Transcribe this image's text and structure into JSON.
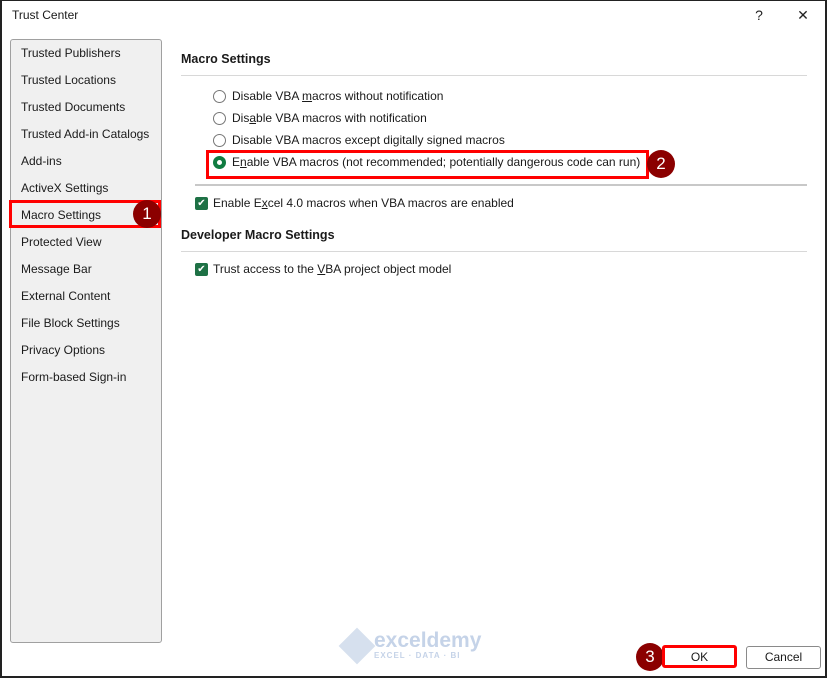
{
  "window": {
    "title": "Trust Center",
    "help_icon": "?",
    "close_icon": "✕"
  },
  "sidebar": {
    "items": [
      {
        "label": "Trusted Publishers"
      },
      {
        "label": "Trusted Locations"
      },
      {
        "label": "Trusted Documents"
      },
      {
        "label": "Trusted Add-in Catalogs"
      },
      {
        "label": "Add-ins"
      },
      {
        "label": "ActiveX Settings"
      },
      {
        "label": "Macro Settings",
        "selected": true
      },
      {
        "label": "Protected View"
      },
      {
        "label": "Message Bar"
      },
      {
        "label": "External Content"
      },
      {
        "label": "File Block Settings"
      },
      {
        "label": "Privacy Options"
      },
      {
        "label": "Form-based Sign-in"
      }
    ]
  },
  "macro": {
    "heading": "Macro Settings",
    "options": [
      {
        "pre": "Disable VBA ",
        "key": "m",
        "post": "acros without notification",
        "checked": false
      },
      {
        "pre": "Dis",
        "key": "a",
        "post": "ble VBA macros with notification",
        "checked": false
      },
      {
        "pre": "Disable VBA macros except di",
        "key": "g",
        "post": "itally signed macros",
        "checked": false
      },
      {
        "pre": "E",
        "key": "n",
        "post": "able VBA macros (not recommended; potentially dangerous code can run)",
        "checked": true
      }
    ],
    "excel4": {
      "pre": "Enable E",
      "key": "x",
      "post": "cel 4.0 macros when VBA macros are enabled",
      "checked": true
    }
  },
  "developer": {
    "heading": "Developer Macro Settings",
    "trust": {
      "pre": "Trust access to the ",
      "key": "V",
      "post": "BA project object model",
      "checked": true
    }
  },
  "buttons": {
    "ok": "OK",
    "cancel": "Cancel"
  },
  "badges": [
    "1",
    "2",
    "3"
  ],
  "watermark": {
    "name": "exceldemy",
    "tagline": "EXCEL · DATA · BI"
  },
  "colors": {
    "highlight": "#ff0000",
    "badge": "#8b0000",
    "check": "#107c41"
  }
}
